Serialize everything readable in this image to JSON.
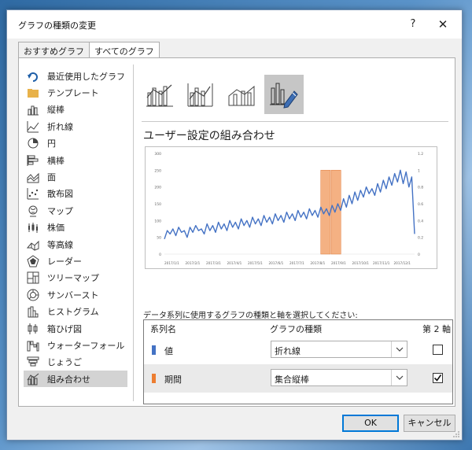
{
  "dialog": {
    "title": "グラフの種類の変更",
    "help_label": "?",
    "close_label": "✕"
  },
  "tabs": [
    {
      "label": "おすすめグラフ",
      "active": false
    },
    {
      "label": "すべてのグラフ",
      "active": true
    }
  ],
  "chart_types": [
    {
      "label": "最近使用したグラフ",
      "icon": "undo-icon"
    },
    {
      "label": "テンプレート",
      "icon": "folder-icon"
    },
    {
      "label": "縦棒",
      "icon": "column-chart-icon"
    },
    {
      "label": "折れ線",
      "icon": "line-chart-icon"
    },
    {
      "label": "円",
      "icon": "pie-chart-icon"
    },
    {
      "label": "横棒",
      "icon": "bar-chart-icon"
    },
    {
      "label": "面",
      "icon": "area-chart-icon"
    },
    {
      "label": "散布図",
      "icon": "scatter-chart-icon"
    },
    {
      "label": "マップ",
      "icon": "map-icon"
    },
    {
      "label": "株価",
      "icon": "stock-chart-icon"
    },
    {
      "label": "等高線",
      "icon": "surface-chart-icon"
    },
    {
      "label": "レーダー",
      "icon": "radar-chart-icon"
    },
    {
      "label": "ツリーマップ",
      "icon": "treemap-icon"
    },
    {
      "label": "サンバースト",
      "icon": "sunburst-icon"
    },
    {
      "label": "ヒストグラム",
      "icon": "histogram-icon"
    },
    {
      "label": "箱ひげ図",
      "icon": "box-whisker-icon"
    },
    {
      "label": "ウォーターフォール",
      "icon": "waterfall-icon"
    },
    {
      "label": "じょうご",
      "icon": "funnel-icon"
    },
    {
      "label": "組み合わせ",
      "icon": "combo-chart-icon",
      "selected": true
    }
  ],
  "subtypes": [
    {
      "icon": "clustered-column-line-icon"
    },
    {
      "icon": "clustered-column-line-secondary-icon"
    },
    {
      "icon": "stacked-area-column-icon"
    },
    {
      "icon": "custom-combo-icon",
      "selected": true
    }
  ],
  "section_title": "ユーザー設定の組み合わせ",
  "preview_chart": {
    "left_axis_ticks": [
      "300",
      "250",
      "200",
      "150",
      "100",
      "50",
      "0"
    ],
    "right_axis_ticks": [
      "1.2",
      "1",
      "0.8",
      "0.6",
      "0.4",
      "0.2",
      "0"
    ],
    "x_ticks": [
      "2017/1/1",
      "2017/2/1",
      "2017/3/1",
      "2017/4/1",
      "2017/5/1",
      "2017/6/1",
      "2017/7/1",
      "2017/8/1",
      "2017/9/1",
      "2017/10/1",
      "2017/11/1",
      "2017/12/1"
    ],
    "line_color": "#4472c4",
    "bar_color": "#f4b183"
  },
  "chart_data": {
    "type": "line",
    "ylim": [
      0,
      300
    ],
    "y2lim": [
      0,
      1.2
    ],
    "series": [
      {
        "name": "値",
        "type": "line",
        "color": "#4472c4",
        "values": [
          45,
          70,
          60,
          75,
          55,
          80,
          65,
          70,
          50,
          80,
          65,
          85,
          70,
          75,
          60,
          90,
          70,
          85,
          65,
          95,
          75,
          90,
          70,
          100,
          80,
          95,
          75,
          105,
          85,
          100,
          80,
          110,
          90,
          105,
          85,
          115,
          95,
          110,
          90,
          120,
          100,
          115,
          95,
          125,
          105,
          120,
          100,
          130,
          110,
          125,
          105,
          135,
          115,
          130,
          110,
          140,
          120,
          135,
          115,
          145,
          125,
          150,
          130,
          165,
          140,
          175,
          150,
          185,
          160,
          190,
          170,
          200,
          180,
          195,
          175,
          210,
          185,
          220,
          195,
          230,
          205,
          240,
          215,
          250,
          210,
          245,
          200,
          230,
          60
        ]
      },
      {
        "name": "期間",
        "type": "bar",
        "color": "#f4b183",
        "axis": "secondary",
        "x_start": "2017/8/1",
        "x_end": "2017/9/1",
        "value": 1
      }
    ]
  },
  "series_panel": {
    "instruction": "データ系列に使用するグラフの種類と軸を選択してください:",
    "col_name": "系列名",
    "col_type": "グラフの種類",
    "col_axis": "第 2 軸",
    "rows": [
      {
        "name": "値",
        "color": "#4472c4",
        "type": "折れ線",
        "secondary_axis": false
      },
      {
        "name": "期間",
        "color": "#ed7d31",
        "type": "集合縦棒",
        "secondary_axis": true
      }
    ]
  },
  "buttons": {
    "ok": "OK",
    "cancel": "キャンセル"
  }
}
